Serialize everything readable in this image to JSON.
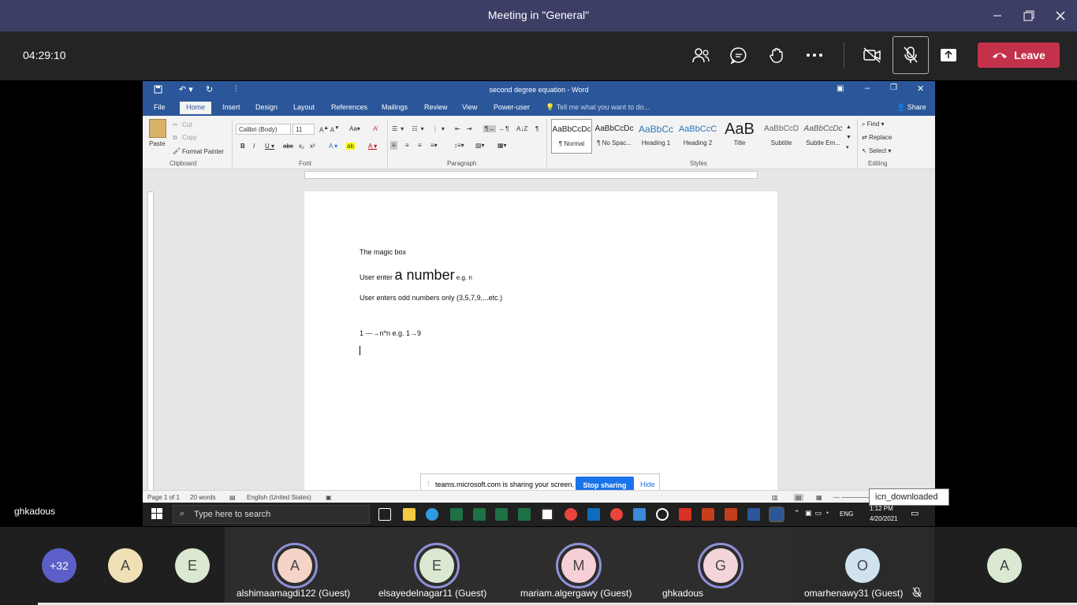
{
  "window": {
    "title": "Meeting in \"General\""
  },
  "meeting": {
    "timer": "04:29:10",
    "leave_label": "Leave"
  },
  "word": {
    "title": "second degree equation - Word",
    "tabs": [
      "File",
      "Home",
      "Insert",
      "Design",
      "Layout",
      "References",
      "Mailings",
      "Review",
      "View",
      "Power-user"
    ],
    "tell_me": "Tell me what you want to do...",
    "share": "Share",
    "clipboard": {
      "paste": "Paste",
      "cut": "Cut",
      "copy": "Copy",
      "format_painter": "Format Painter",
      "group": "Clipboard"
    },
    "font": {
      "name": "Calibri (Body)",
      "size": "11",
      "group": "Font"
    },
    "paragraph_group": "Paragraph",
    "styles": [
      {
        "preview": "AaBbCcDc",
        "name": "¶ Normal"
      },
      {
        "preview": "AaBbCcDc",
        "name": "¶ No Spac..."
      },
      {
        "preview": "AaBbCc",
        "name": "Heading 1"
      },
      {
        "preview": "AaBbCcC",
        "name": "Heading 2"
      },
      {
        "preview": "AaB",
        "name": "Title"
      },
      {
        "preview": "AaBbCcD",
        "name": "Subtitle"
      },
      {
        "preview": "AaBbCcDc",
        "name": "Subtle Em..."
      }
    ],
    "styles_group": "Styles",
    "editing": {
      "find": "Find",
      "replace": "Replace",
      "select": "Select",
      "group": "Editing"
    },
    "doc": {
      "line1": "The magic box",
      "line2_a": "User enter ",
      "line2_b": "a number",
      "line2_c": " e.g. n",
      "line3": "User enters odd numbers only (3,5,7,9,...etc.)",
      "line4": "1 ---→n*n  e.g. 1→9"
    },
    "status": {
      "page": "Page 1 of 1",
      "words": "20 words",
      "lang": "English (United States)"
    },
    "share_bar": {
      "text": "teams.microsoft.com is sharing your screen.",
      "stop": "Stop sharing",
      "hide": "Hide"
    },
    "taskbar": {
      "search": "Type here to search",
      "time": "1:12 PM",
      "date": "4/20/2021",
      "lang": "ENG"
    }
  },
  "tooltip": "icn_downloaded",
  "presenter": "ghkadous",
  "overflow_count": "+32",
  "participants": [
    {
      "initial": "A",
      "name": "",
      "color": "#f1dfb6"
    },
    {
      "initial": "E",
      "name": "",
      "color": "#dbe8d2"
    },
    {
      "initial": "A",
      "name": "alshimaamagdi122 (Guest)",
      "color": "#f6d3c7"
    },
    {
      "initial": "E",
      "name": "elsayedelnagar11 (Guest)",
      "color": "#dbe8d2"
    },
    {
      "initial": "M",
      "name": "mariam.algergawy (Guest)",
      "color": "#f6d0d6"
    },
    {
      "initial": "G",
      "name": "ghkadous",
      "color": "#f3d5d9"
    },
    {
      "initial": "O",
      "name": "omarhenawy31 (Guest)",
      "color": "#cfe2ee"
    },
    {
      "initial": "A",
      "name": "",
      "color": "#dbe8d2"
    }
  ],
  "colors": {
    "accent": "#3d3e66",
    "leave": "#c4314b",
    "word": "#2b579a"
  }
}
